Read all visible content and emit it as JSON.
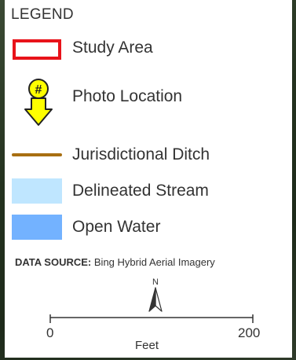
{
  "legend": {
    "title": "LEGEND",
    "items": [
      {
        "label": "Study Area",
        "icon": "red-outline-rectangle",
        "color": "#e8131a"
      },
      {
        "label": "Photo Location",
        "icon": "photo-location-pin",
        "symbol": "#",
        "color": "#ffff00"
      },
      {
        "label": "Jurisdictional Ditch",
        "icon": "brown-line",
        "color": "#a86f12"
      },
      {
        "label": "Delineated Stream",
        "icon": "light-blue-fill",
        "color": "#bfe6ff"
      },
      {
        "label": "Open Water",
        "icon": "blue-fill",
        "color": "#73b2ff"
      }
    ]
  },
  "data_source": {
    "label": "DATA SOURCE:",
    "value": "Bing Hybrid Aerial Imagery"
  },
  "north_arrow": {
    "label": "N"
  },
  "scale_bar": {
    "start": "0",
    "end": "200",
    "unit": "Feet"
  }
}
